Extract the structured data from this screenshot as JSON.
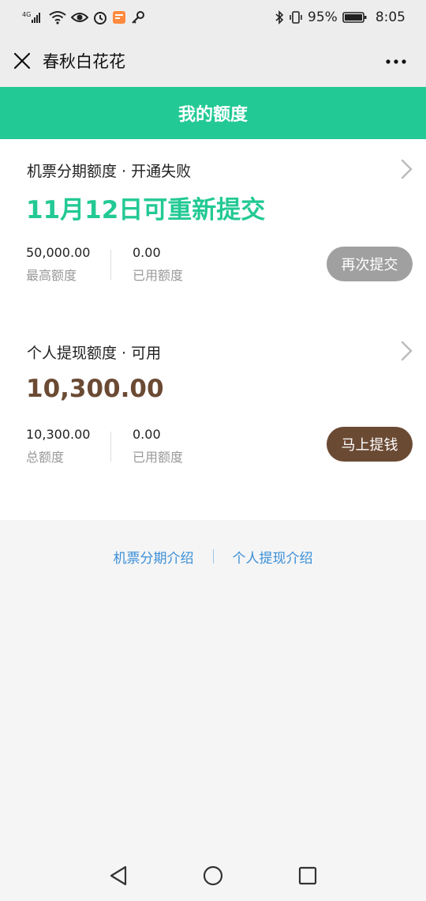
{
  "status_bar": {
    "network": "4G",
    "battery_percent": "95%",
    "time": "8:05"
  },
  "title_bar": {
    "title": "春秋白花花"
  },
  "header": {
    "title": "我的额度"
  },
  "cards": [
    {
      "title": "机票分期额度 · 开通失败",
      "big_value": "11月12日可重新提交",
      "stat1_value": "50,000.00",
      "stat1_label": "最高额度",
      "stat2_value": "0.00",
      "stat2_label": "已用额度",
      "button_label": "再次提交"
    },
    {
      "title": "个人提现额度 · 可用",
      "big_value": "10,300.00",
      "stat1_value": "10,300.00",
      "stat1_label": "总额度",
      "stat2_value": "0.00",
      "stat2_label": "已用额度",
      "button_label": "马上提钱"
    }
  ],
  "links": {
    "left": "机票分期介绍",
    "right": "个人提现介绍"
  },
  "colors": {
    "accent_green": "#23c994",
    "accent_brown": "#6b4a34",
    "link_blue": "#3a8fd8"
  }
}
